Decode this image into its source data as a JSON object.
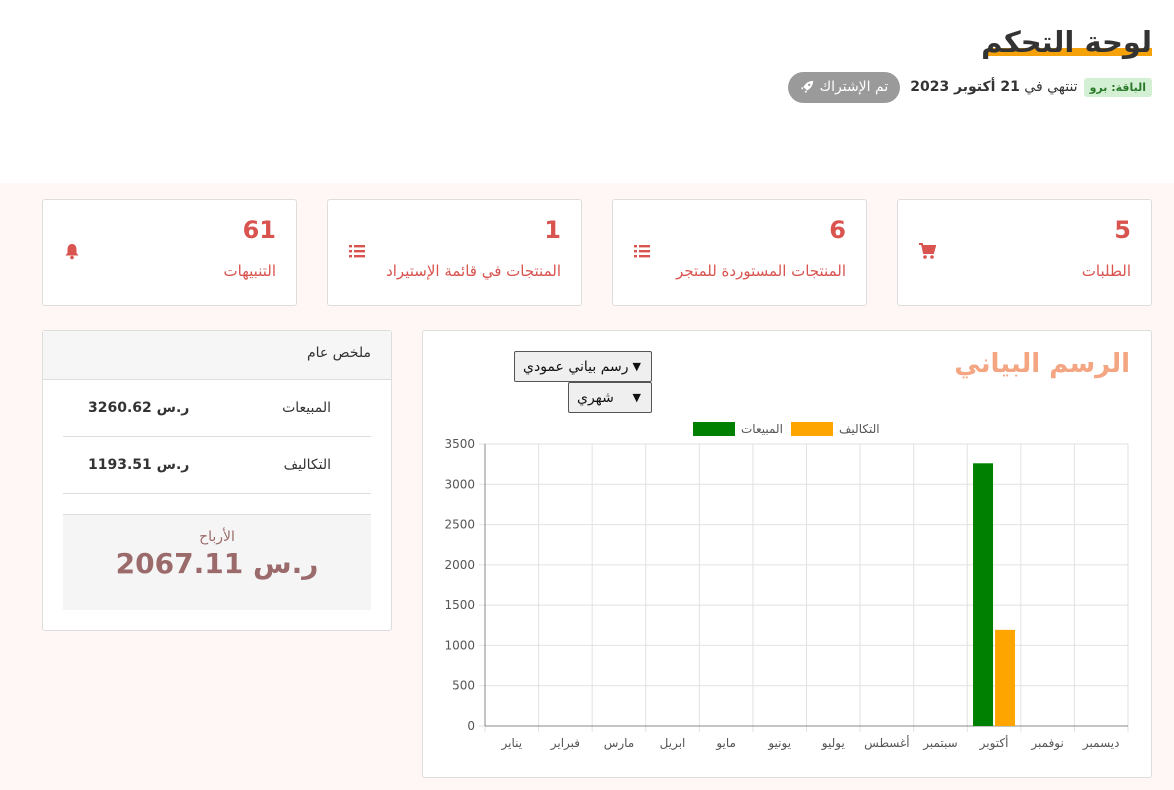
{
  "header": {
    "title": "لوحة التحكم",
    "plan_badge": "الباقة: برو",
    "expire_prefix": "تنتهي في",
    "expire_date": "21 أكتوبر 2023",
    "subscribed_label": "تم الإشتراك",
    "subscribed_icon": "rocket-icon"
  },
  "stats": [
    {
      "value": "5",
      "label": "الطلبات",
      "icon": "cart-icon"
    },
    {
      "value": "6",
      "label": "المنتجات المستوردة للمتجر",
      "icon": "list-icon"
    },
    {
      "value": "1",
      "label": "المنتجات في قائمة الإستيراد",
      "icon": "list-icon"
    },
    {
      "value": "61",
      "label": "التنبيهات",
      "icon": "bell-icon"
    }
  ],
  "summary": {
    "title": "ملخص عام",
    "rows": [
      {
        "label": "المبيعات",
        "value": "3260.62 ر.س"
      },
      {
        "label": "التكاليف",
        "value": "1193.51 ر.س"
      }
    ],
    "profit_label": "الأرباح",
    "profit_value": "2067.11 ر.س"
  },
  "chart_panel": {
    "title": "الرسم البياني",
    "chart_type_select": "رسم بياني عمودي",
    "period_select": "شهري"
  },
  "colors": {
    "accent": "#d9534f",
    "title_underline": "#f5a10a",
    "sales": "#008000",
    "costs": "#ffa500",
    "chart_title": "#f4a582"
  },
  "chart_data": {
    "type": "bar",
    "categories": [
      "يناير",
      "فبراير",
      "مارس",
      "ابريل",
      "مايو",
      "يونيو",
      "يوليو",
      "أغسطس",
      "سبتمبر",
      "أكتوبر",
      "نوفمبر",
      "ديسمبر"
    ],
    "series": [
      {
        "name": "المبيعات",
        "color": "#008000",
        "values": [
          0,
          0,
          0,
          0,
          0,
          0,
          0,
          0,
          0,
          3260.62,
          0,
          0
        ]
      },
      {
        "name": "التكاليف",
        "color": "#ffa500",
        "values": [
          0,
          0,
          0,
          0,
          0,
          0,
          0,
          0,
          0,
          1193.51,
          0,
          0
        ]
      }
    ],
    "ylim": [
      0,
      3500
    ],
    "yticks": [
      "0",
      "500",
      "1000",
      "1500",
      "2000",
      "2500",
      "3000",
      "3500"
    ],
    "grid": true,
    "legend": "top"
  }
}
